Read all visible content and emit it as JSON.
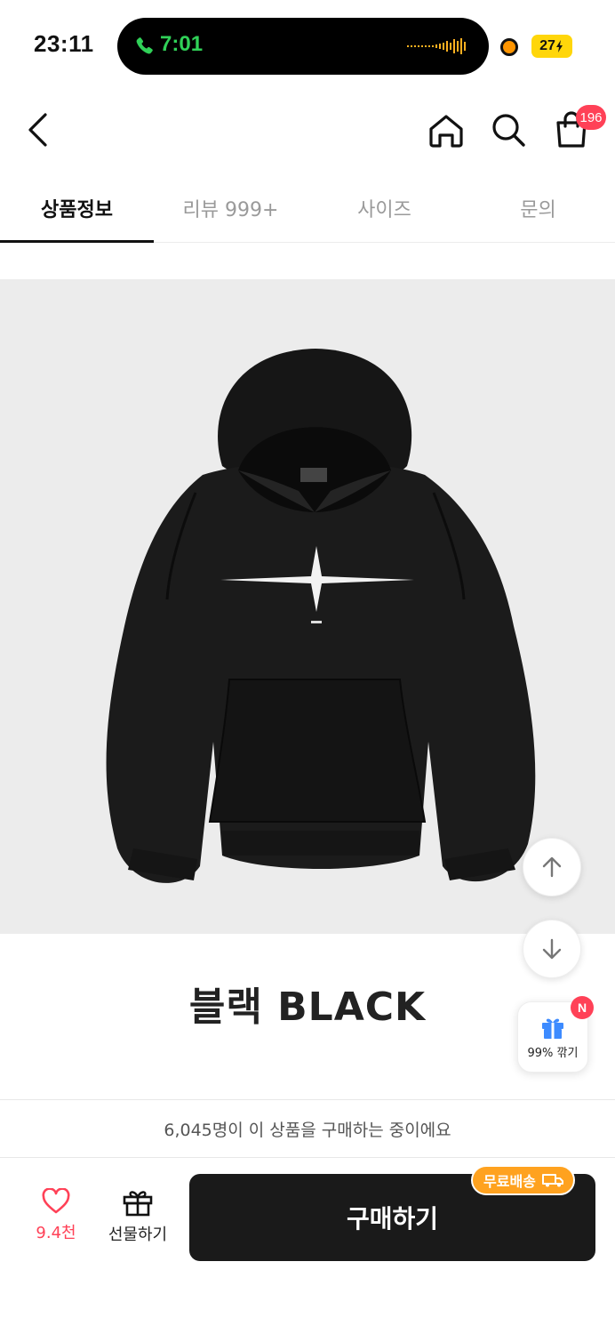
{
  "status_bar": {
    "time": "23:11",
    "call_time": "7:01",
    "battery": "27"
  },
  "header": {
    "cart_count": "196"
  },
  "tabs": [
    {
      "label": "상품정보",
      "active": true
    },
    {
      "label": "리뷰 999+",
      "active": false
    },
    {
      "label": "사이즈",
      "active": false
    },
    {
      "label": "문의",
      "active": false
    }
  ],
  "product": {
    "name": "블랙 BLACK"
  },
  "floating": {
    "bargain_badge": "N",
    "bargain_label": "99% 깎기"
  },
  "notice": {
    "text": "6,045명이 이 상품을 구매하는 중이에요"
  },
  "bottom_bar": {
    "like_count": "9.4천",
    "gift_label": "선물하기",
    "buy_label": "구매하기",
    "shipping_badge": "무료배송"
  },
  "colors": {
    "accent_red": "#ff4157",
    "shipping_orange": "#ffa21f",
    "buy_button": "#1a1a1a"
  }
}
